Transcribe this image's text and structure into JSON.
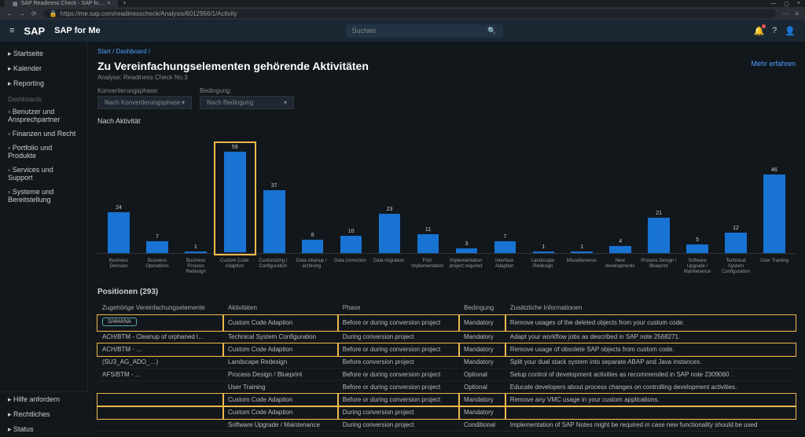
{
  "browser": {
    "tab_title": "SAP Readiness Check - SAP fo…",
    "url": "https://me.sap.com/readinesscheck/Analysis/6012956/1/Activity"
  },
  "header": {
    "logo": "SAP",
    "app": "SAP for Me",
    "search_placeholder": "Suchen"
  },
  "sidebar": {
    "main": [
      "Startseite",
      "Kalender",
      "Reporting"
    ],
    "section": "Dashboards",
    "items": [
      "Benutzer und Ansprechpartner",
      "Finanzen und Recht",
      "Portfolio und Produkte",
      "Services und Support",
      "Systeme und Bereitstellung"
    ],
    "bottom": [
      "Hilfe anfordern",
      "Rechtliches",
      "Status"
    ]
  },
  "page": {
    "crumb1": "Start",
    "crumb2": "Dashboard",
    "title": "Zu Vereinfachungselementen gehörende Aktivitäten",
    "subtitle": "Analyse: Readiness Check No.3",
    "mehr": "Mehr erfahren",
    "filter1_label": "Konvertierungsphase:",
    "filter1_value": "Nach Konvertierungsphase",
    "filter2_label": "Bedingung:",
    "filter2_value": "Nach Bedingung",
    "chart_title": "Nach Aktivität"
  },
  "chart_data": {
    "type": "bar",
    "categories": [
      "Business Decision",
      "Business Operations",
      "Business Process Redesign",
      "Custom Code Adaption",
      "Customizing / Configuration",
      "Data cleanup / archiving",
      "Data correction",
      "Data migration",
      "FIori Implementation",
      "Implementation project required",
      "Interface Adaption",
      "Landscape Redesign",
      "Miscellaneous",
      "New developments",
      "Process Design / Blueprint",
      "Software Upgrade / Maintenance",
      "Technical System Configuration",
      "User Training"
    ],
    "values": [
      24,
      7,
      1,
      59,
      37,
      8,
      10,
      23,
      11,
      3,
      7,
      1,
      1,
      4,
      21,
      5,
      12,
      46
    ],
    "highlighted_index": 3,
    "ylim": [
      0,
      60
    ]
  },
  "positions": {
    "title": "Positionen (293)",
    "columns": [
      "Zugehörige Vereinfachungselemente",
      "Aktivitäten",
      "Phase",
      "Bedingung",
      "Zusätzliche Informationen"
    ],
    "left_items": [
      {
        "tag": "S/4HANA",
        "text": ""
      },
      {
        "tag": "",
        "text": "ACH/BTM - Cleanup of orphaned l…"
      },
      {
        "tag": "",
        "text": "ACH/BTM - …"
      },
      {
        "tag": "",
        "text": "(SU3_AG_ADO_…)"
      },
      {
        "tag": "",
        "text": "AFS/BTM - …"
      }
    ],
    "rows": [
      {
        "a": "Custom Code Adaption",
        "p": "Before or during conversion project",
        "b": "Mandatory",
        "z": "Remove usages of the deleted objects from your custom code.",
        "hl": true
      },
      {
        "a": "Technical System Configuration",
        "p": "During conversion project",
        "b": "Mandatory",
        "z": "Adapt your workflow jobs as described in SAP note 2568271.",
        "hl": false
      },
      {
        "a": "Custom Code Adaption",
        "p": "Before or during conversion project",
        "b": "Mandatory",
        "z": "Remove usage of obsolete SAP objects from custom code.",
        "hl": true
      },
      {
        "a": "Landscape Redesign",
        "p": "Before conversion project",
        "b": "Mandatory",
        "z": "Split your dual stack system into separate ABAP and Java instances.",
        "hl": false
      },
      {
        "a": "Process Design / Blueprint",
        "p": "Before or during conversion project",
        "b": "Optional",
        "z": "Setup control of development activities as recommended in SAP note 2309060 .",
        "hl": false
      },
      {
        "a": "User Training",
        "p": "Before or during conversion project",
        "b": "Optional",
        "z": "Educate developers about process changes on controlling development activities.",
        "hl": false
      },
      {
        "a": "Custom Code Adaption",
        "p": "Before or during conversion project",
        "b": "Mandatory",
        "z": "Remove any VMC usage in your custom applications.",
        "hl": true
      },
      {
        "a": "Custom Code Adaption",
        "p": "During conversion project",
        "b": "Mandatory",
        "z": "",
        "hl": true
      },
      {
        "a": "Software Upgrade / Maintenance",
        "p": "During conversion project",
        "b": "Conditional",
        "z": "Implementation of SAP Notes might be required in case new functionality should be used",
        "hl": false
      }
    ]
  }
}
